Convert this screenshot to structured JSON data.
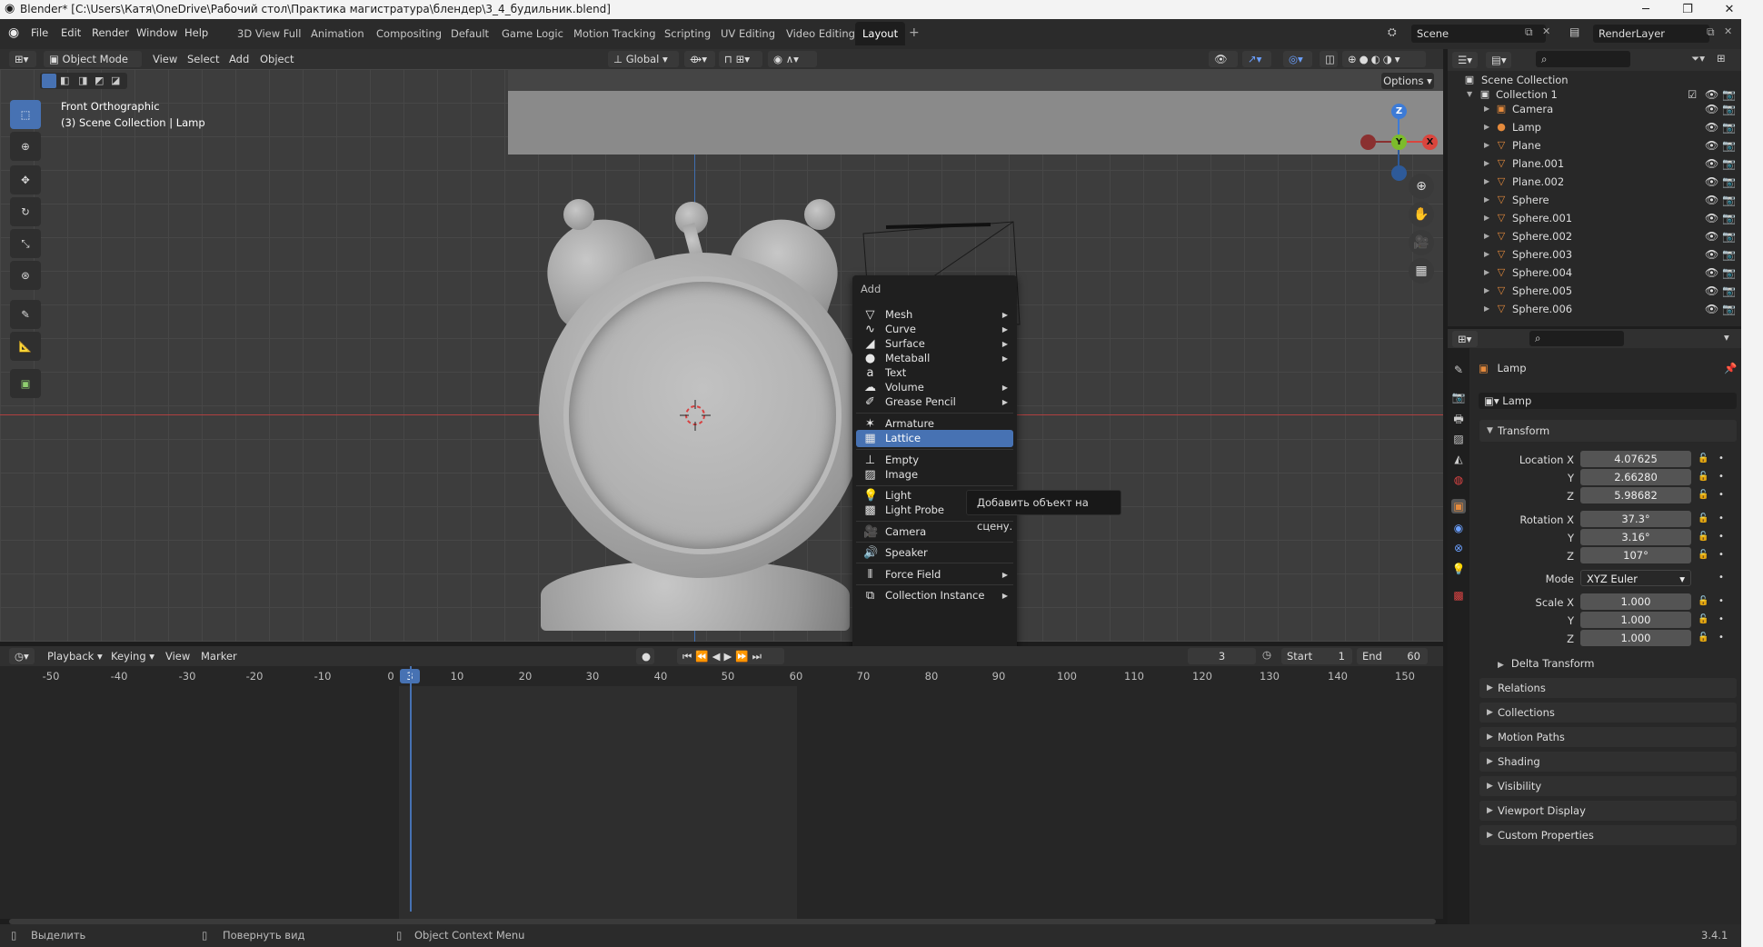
{
  "window": {
    "title": "Blender* [C:\\Users\\Катя\\OneDrive\\Рабочий стол\\Практика магистратура\\блендер\\3_4_будильник.blend]"
  },
  "menubar": {
    "items": [
      "File",
      "Edit",
      "Render",
      "Window",
      "Help"
    ]
  },
  "workspaces": {
    "tabs": [
      "3D View Full",
      "Animation",
      "Compositing",
      "Default",
      "Game Logic",
      "Motion Tracking",
      "Scripting",
      "UV Editing",
      "Video Editing",
      "Layout"
    ],
    "active": "Layout"
  },
  "scene": {
    "name": "Scene",
    "view_layer": "RenderLayer"
  },
  "viewport_header": {
    "mode": "Object Mode",
    "menus": [
      "View",
      "Select",
      "Add",
      "Object"
    ],
    "orientation": "Global",
    "options": "Options"
  },
  "viewport": {
    "view_name": "Front Orthographic",
    "collection_info": "(3) Scene Collection | Lamp"
  },
  "gizmo": {
    "z": "Z",
    "y": "Y",
    "x": "X"
  },
  "add_menu": {
    "title": "Add",
    "items": [
      {
        "label": "Mesh",
        "icon": "mesh-icon",
        "submenu": true
      },
      {
        "label": "Curve",
        "icon": "curve-icon",
        "submenu": true
      },
      {
        "label": "Surface",
        "icon": "surface-icon",
        "submenu": true
      },
      {
        "label": "Metaball",
        "icon": "metaball-icon",
        "submenu": true
      },
      {
        "label": "Text",
        "icon": "text-icon",
        "submenu": false
      },
      {
        "label": "Volume",
        "icon": "volume-icon",
        "submenu": true
      },
      {
        "label": "Grease Pencil",
        "icon": "grease-pencil-icon",
        "submenu": true
      },
      {
        "label": "Armature",
        "icon": "armature-icon",
        "submenu": false
      },
      {
        "label": "Lattice",
        "icon": "lattice-icon",
        "submenu": false,
        "selected": true
      },
      {
        "label": "Empty",
        "icon": "empty-icon",
        "submenu": true
      },
      {
        "label": "Image",
        "icon": "image-icon",
        "submenu": true
      },
      {
        "label": "Light",
        "icon": "light-icon",
        "submenu": true
      },
      {
        "label": "Light Probe",
        "icon": "light-probe-icon",
        "submenu": true
      },
      {
        "label": "Camera",
        "icon": "camera-icon",
        "submenu": false
      },
      {
        "label": "Speaker",
        "icon": "speaker-icon",
        "submenu": false
      },
      {
        "label": "Force Field",
        "icon": "force-field-icon",
        "submenu": true
      },
      {
        "label": "Collection Instance",
        "icon": "collection-instance-icon",
        "submenu": true
      }
    ],
    "tooltip": "Добавить объект на сцену."
  },
  "timeline": {
    "menus": [
      "Playback",
      "Keying",
      "View",
      "Marker"
    ],
    "current_frame": "3",
    "start_label": "Start",
    "start": "1",
    "end_label": "End",
    "end": "60",
    "ticks": [
      "-50",
      "-40",
      "-30",
      "-20",
      "-10",
      "0",
      "10",
      "20",
      "30",
      "40",
      "50",
      "60",
      "70",
      "80",
      "90",
      "100",
      "110",
      "120",
      "130",
      "140",
      "150"
    ]
  },
  "statusbar": {
    "select": "Выделить",
    "rotate": "Повернуть вид",
    "context": "Object Context Menu",
    "version": "3.4.1"
  },
  "outliner": {
    "root": "Scene Collection",
    "collection": "Collection 1",
    "objects": [
      {
        "name": "Camera",
        "icon": "camera-object-icon"
      },
      {
        "name": "Lamp",
        "icon": "light-object-icon"
      },
      {
        "name": "Plane",
        "icon": "mesh-object-icon"
      },
      {
        "name": "Plane.001",
        "icon": "mesh-object-icon"
      },
      {
        "name": "Plane.002",
        "icon": "mesh-object-icon"
      },
      {
        "name": "Sphere",
        "icon": "mesh-object-icon"
      },
      {
        "name": "Sphere.001",
        "icon": "mesh-object-icon"
      },
      {
        "name": "Sphere.002",
        "icon": "mesh-object-icon"
      },
      {
        "name": "Sphere.003",
        "icon": "mesh-object-icon"
      },
      {
        "name": "Sphere.004",
        "icon": "mesh-object-icon"
      },
      {
        "name": "Sphere.005",
        "icon": "mesh-object-icon"
      },
      {
        "name": "Sphere.006",
        "icon": "mesh-object-icon"
      }
    ]
  },
  "properties": {
    "object_name": "Lamp",
    "data_name": "Lamp",
    "transform": {
      "title": "Transform",
      "location_label": "Location X",
      "location": [
        "4.07625",
        "2.66280",
        "5.98682"
      ],
      "rotation_label": "Rotation X",
      "rotation": [
        "37.3°",
        "3.16°",
        "107°"
      ],
      "mode_label": "Mode",
      "mode": "XYZ Euler",
      "scale_label": "Scale X",
      "scale": [
        "1.000",
        "1.000",
        "1.000"
      ],
      "y": "Y",
      "z": "Z",
      "delta": "Delta Transform"
    },
    "sections": [
      "Relations",
      "Collections",
      "Motion Paths",
      "Shading",
      "Visibility",
      "Viewport Display",
      "Custom Properties"
    ]
  },
  "colors": {
    "accent": "#4772b3",
    "axis_x": "#d9453d",
    "axis_y": "#7cbc2b",
    "axis_z": "#3d7bd6",
    "object_icon": "#e58a3c"
  }
}
